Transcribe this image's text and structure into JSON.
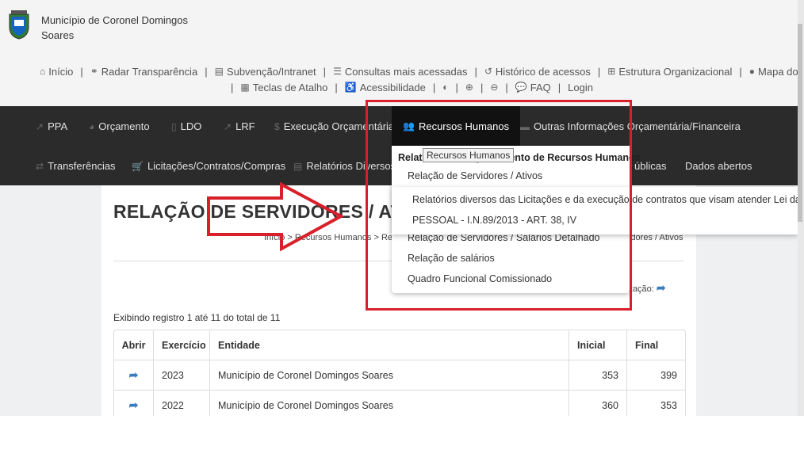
{
  "header": {
    "municipality": "Município de Coronel Domingos Soares"
  },
  "toplinks": {
    "row1": [
      {
        "label": "Início",
        "icon": "home-icon",
        "glyph": "⌂"
      },
      {
        "label": "Radar Transparência",
        "icon": "link-icon",
        "glyph": "⚭"
      },
      {
        "label": "Subvenção/Intranet",
        "icon": "id-card-icon",
        "glyph": "▤"
      },
      {
        "label": "Consultas mais acessadas",
        "icon": "list-icon",
        "glyph": "☰"
      },
      {
        "label": "Histórico de acessos",
        "icon": "history-icon",
        "glyph": "↺"
      },
      {
        "label": "Estrutura Organizacional",
        "icon": "sitemap-icon",
        "glyph": "⊞"
      },
      {
        "label": "Mapa do site",
        "icon": "map-marker-icon",
        "glyph": "●"
      }
    ],
    "row2": [
      {
        "label": "Teclas de Atalho",
        "icon": "keyboard-icon",
        "glyph": "▦"
      },
      {
        "label": "Acessibilidade",
        "icon": "wheelchair-icon",
        "glyph": "♿"
      },
      {
        "label": "",
        "icon": "contrast-icon",
        "glyph": "◐"
      },
      {
        "label": "",
        "icon": "zoom-in-icon",
        "glyph": "⊕"
      },
      {
        "label": "",
        "icon": "zoom-out-icon",
        "glyph": "⊖"
      },
      {
        "label": "FAQ",
        "icon": "comment-icon",
        "glyph": "💬"
      },
      {
        "label": "Login",
        "icon": "",
        "glyph": ""
      }
    ]
  },
  "nav": {
    "row1": [
      {
        "label": "PPA",
        "glyph": "↗"
      },
      {
        "label": "Orçamento",
        "glyph": "◕"
      },
      {
        "label": "LDO",
        "glyph": "▯"
      },
      {
        "label": "LRF",
        "glyph": "↗"
      },
      {
        "label": "Execução Orçamentária",
        "glyph": "$"
      },
      {
        "label": "Recursos Humanos",
        "glyph": "👥"
      },
      {
        "label": "Outras Informações Orçamentária/Financeira",
        "glyph": "▬"
      }
    ],
    "row2": [
      {
        "label": "Transferências",
        "glyph": "⇄"
      },
      {
        "label": "Licitações/Contratos/Compras",
        "glyph": "🛒"
      },
      {
        "label": "Relatórios Diversos",
        "glyph": "▤"
      },
      {
        "label": "úblicas",
        "glyph": ""
      },
      {
        "label": "Dados abertos",
        "glyph": ""
      }
    ]
  },
  "dropdown": {
    "title": "Relatórios de Departamento de Recursos Humanos",
    "tooltip": "Recursos Humanos",
    "items": [
      "Relação de Servidores / Ativos",
      "Relação de Servidores / Salários Detalhado",
      "Relação de salários",
      "Quadro Funcional Comissionado"
    ],
    "submenu": [
      "Relatórios diversos das Licitações e da execução de contratos que visam atender Lei da Transpari",
      "PESSOAL - I.N.89/2013 - ART. 38, IV"
    ]
  },
  "main": {
    "title": "RELAÇÃO DE SERVIDORES / ATIVOS",
    "breadcrumb": "Início > Recursos Humanos > Relat",
    "breadcrumb_end": "idores / Ativos",
    "update_label": "ização:",
    "showing": "Exibindo registro 1 até 11 do total de 11"
  },
  "table": {
    "headers": [
      "Abrir",
      "Exercício",
      "Entidade",
      "Inicial",
      "Final"
    ],
    "rows": [
      {
        "year": "2023",
        "entity": "Município de Coronel Domingos Soares",
        "initial": "353",
        "final": "399"
      },
      {
        "year": "2022",
        "entity": "Município de Coronel Domingos Soares",
        "initial": "360",
        "final": "353"
      }
    ]
  },
  "colors": {
    "nav_bg": "#2b2b2b",
    "highlight": "#d9202a",
    "link_icon": "#3a7cc1"
  }
}
